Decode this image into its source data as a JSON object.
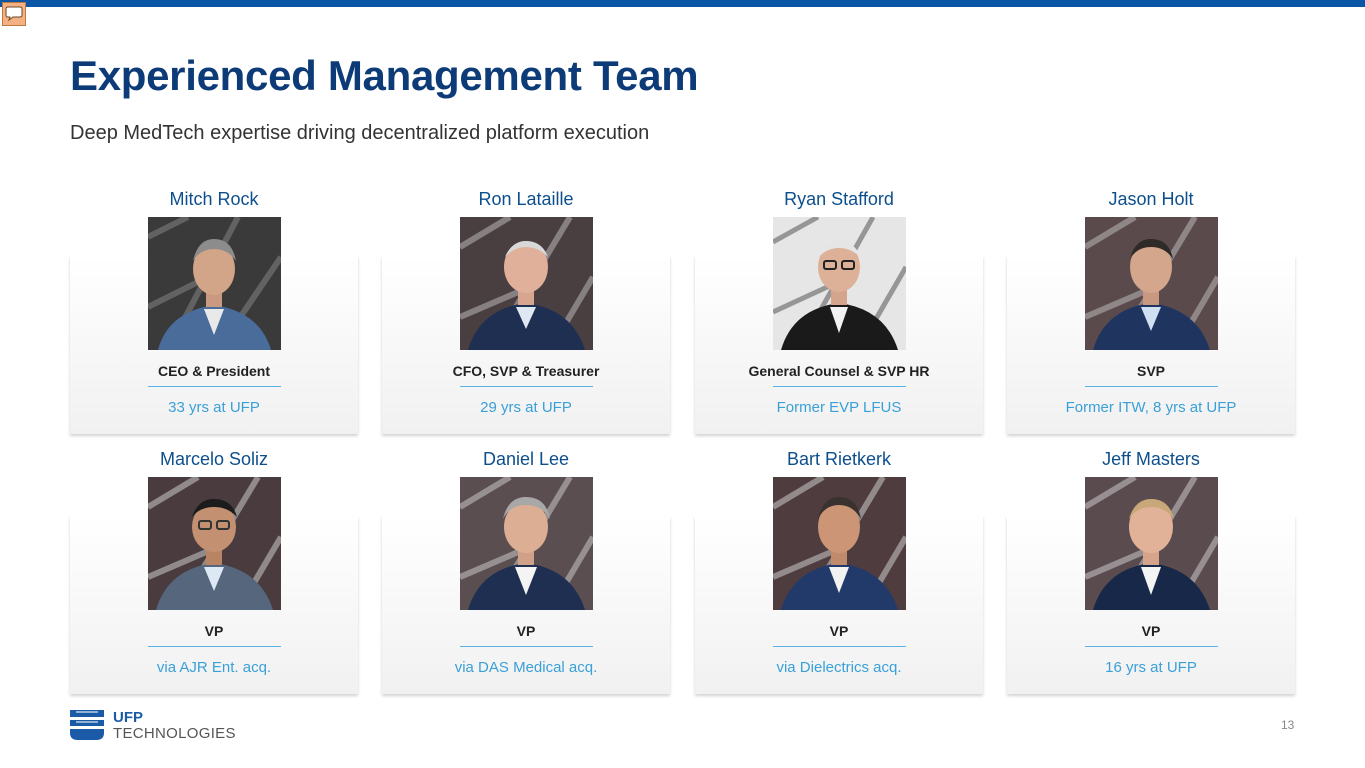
{
  "slide": {
    "title": "Experienced Management Team",
    "subtitle": "Deep MedTech expertise driving decentralized platform execution",
    "page_number": "13"
  },
  "team": [
    {
      "name": "Mitch Rock",
      "role": "CEO & President",
      "tenure": "33 yrs at UFP"
    },
    {
      "name": "Ron Lataille",
      "role": "CFO, SVP & Treasurer",
      "tenure": "29 yrs at UFP"
    },
    {
      "name": "Ryan Stafford",
      "role": "General Counsel & SVP HR",
      "tenure": "Former EVP LFUS"
    },
    {
      "name": "Jason Holt",
      "role": "SVP",
      "tenure": "Former ITW, 8 yrs at UFP"
    },
    {
      "name": "Marcelo Soliz",
      "role": "VP",
      "tenure": "via AJR Ent. acq."
    },
    {
      "name": "Daniel Lee",
      "role": "VP",
      "tenure": "via DAS Medical acq."
    },
    {
      "name": "Bart Rietkerk",
      "role": "VP",
      "tenure": "via Dielectrics acq."
    },
    {
      "name": "Jeff Masters",
      "role": "VP",
      "tenure": "16 yrs at UFP"
    }
  ],
  "logo": {
    "line1": "UFP",
    "line2": "TECHNOLOGIES"
  },
  "colors": {
    "brand_blue": "#0a56a5",
    "title_navy": "#0d3b78",
    "name_blue": "#0d4f8c",
    "accent_light_blue": "#3aa0d8"
  },
  "icons": {
    "comment": "comment-icon",
    "logo_mark": "ufp-logo-mark"
  }
}
